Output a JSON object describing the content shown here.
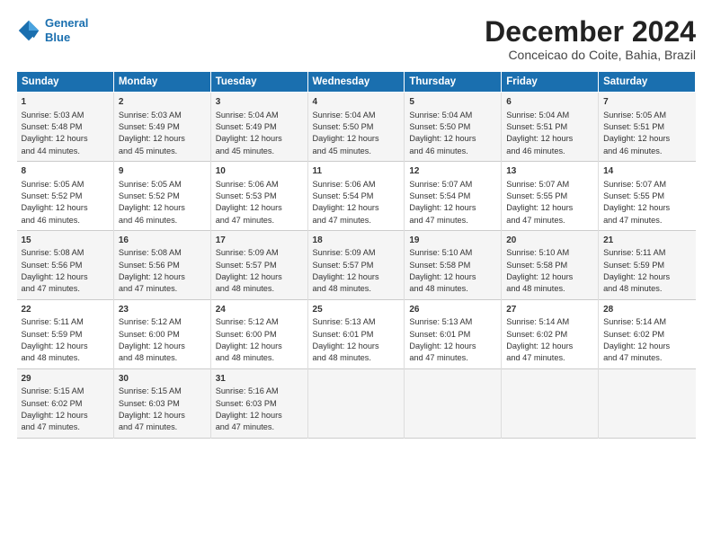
{
  "logo": {
    "line1": "General",
    "line2": "Blue"
  },
  "title": "December 2024",
  "subtitle": "Conceicao do Coite, Bahia, Brazil",
  "columns": [
    "Sunday",
    "Monday",
    "Tuesday",
    "Wednesday",
    "Thursday",
    "Friday",
    "Saturday"
  ],
  "weeks": [
    [
      {
        "day": "1",
        "text": "Sunrise: 5:03 AM\nSunset: 5:48 PM\nDaylight: 12 hours\nand 44 minutes."
      },
      {
        "day": "2",
        "text": "Sunrise: 5:03 AM\nSunset: 5:49 PM\nDaylight: 12 hours\nand 45 minutes."
      },
      {
        "day": "3",
        "text": "Sunrise: 5:04 AM\nSunset: 5:49 PM\nDaylight: 12 hours\nand 45 minutes."
      },
      {
        "day": "4",
        "text": "Sunrise: 5:04 AM\nSunset: 5:50 PM\nDaylight: 12 hours\nand 45 minutes."
      },
      {
        "day": "5",
        "text": "Sunrise: 5:04 AM\nSunset: 5:50 PM\nDaylight: 12 hours\nand 46 minutes."
      },
      {
        "day": "6",
        "text": "Sunrise: 5:04 AM\nSunset: 5:51 PM\nDaylight: 12 hours\nand 46 minutes."
      },
      {
        "day": "7",
        "text": "Sunrise: 5:05 AM\nSunset: 5:51 PM\nDaylight: 12 hours\nand 46 minutes."
      }
    ],
    [
      {
        "day": "8",
        "text": "Sunrise: 5:05 AM\nSunset: 5:52 PM\nDaylight: 12 hours\nand 46 minutes."
      },
      {
        "day": "9",
        "text": "Sunrise: 5:05 AM\nSunset: 5:52 PM\nDaylight: 12 hours\nand 46 minutes."
      },
      {
        "day": "10",
        "text": "Sunrise: 5:06 AM\nSunset: 5:53 PM\nDaylight: 12 hours\nand 47 minutes."
      },
      {
        "day": "11",
        "text": "Sunrise: 5:06 AM\nSunset: 5:54 PM\nDaylight: 12 hours\nand 47 minutes."
      },
      {
        "day": "12",
        "text": "Sunrise: 5:07 AM\nSunset: 5:54 PM\nDaylight: 12 hours\nand 47 minutes."
      },
      {
        "day": "13",
        "text": "Sunrise: 5:07 AM\nSunset: 5:55 PM\nDaylight: 12 hours\nand 47 minutes."
      },
      {
        "day": "14",
        "text": "Sunrise: 5:07 AM\nSunset: 5:55 PM\nDaylight: 12 hours\nand 47 minutes."
      }
    ],
    [
      {
        "day": "15",
        "text": "Sunrise: 5:08 AM\nSunset: 5:56 PM\nDaylight: 12 hours\nand 47 minutes."
      },
      {
        "day": "16",
        "text": "Sunrise: 5:08 AM\nSunset: 5:56 PM\nDaylight: 12 hours\nand 47 minutes."
      },
      {
        "day": "17",
        "text": "Sunrise: 5:09 AM\nSunset: 5:57 PM\nDaylight: 12 hours\nand 48 minutes."
      },
      {
        "day": "18",
        "text": "Sunrise: 5:09 AM\nSunset: 5:57 PM\nDaylight: 12 hours\nand 48 minutes."
      },
      {
        "day": "19",
        "text": "Sunrise: 5:10 AM\nSunset: 5:58 PM\nDaylight: 12 hours\nand 48 minutes."
      },
      {
        "day": "20",
        "text": "Sunrise: 5:10 AM\nSunset: 5:58 PM\nDaylight: 12 hours\nand 48 minutes."
      },
      {
        "day": "21",
        "text": "Sunrise: 5:11 AM\nSunset: 5:59 PM\nDaylight: 12 hours\nand 48 minutes."
      }
    ],
    [
      {
        "day": "22",
        "text": "Sunrise: 5:11 AM\nSunset: 5:59 PM\nDaylight: 12 hours\nand 48 minutes."
      },
      {
        "day": "23",
        "text": "Sunrise: 5:12 AM\nSunset: 6:00 PM\nDaylight: 12 hours\nand 48 minutes."
      },
      {
        "day": "24",
        "text": "Sunrise: 5:12 AM\nSunset: 6:00 PM\nDaylight: 12 hours\nand 48 minutes."
      },
      {
        "day": "25",
        "text": "Sunrise: 5:13 AM\nSunset: 6:01 PM\nDaylight: 12 hours\nand 48 minutes."
      },
      {
        "day": "26",
        "text": "Sunrise: 5:13 AM\nSunset: 6:01 PM\nDaylight: 12 hours\nand 47 minutes."
      },
      {
        "day": "27",
        "text": "Sunrise: 5:14 AM\nSunset: 6:02 PM\nDaylight: 12 hours\nand 47 minutes."
      },
      {
        "day": "28",
        "text": "Sunrise: 5:14 AM\nSunset: 6:02 PM\nDaylight: 12 hours\nand 47 minutes."
      }
    ],
    [
      {
        "day": "29",
        "text": "Sunrise: 5:15 AM\nSunset: 6:02 PM\nDaylight: 12 hours\nand 47 minutes."
      },
      {
        "day": "30",
        "text": "Sunrise: 5:15 AM\nSunset: 6:03 PM\nDaylight: 12 hours\nand 47 minutes."
      },
      {
        "day": "31",
        "text": "Sunrise: 5:16 AM\nSunset: 6:03 PM\nDaylight: 12 hours\nand 47 minutes."
      },
      {
        "day": "",
        "text": ""
      },
      {
        "day": "",
        "text": ""
      },
      {
        "day": "",
        "text": ""
      },
      {
        "day": "",
        "text": ""
      }
    ]
  ]
}
